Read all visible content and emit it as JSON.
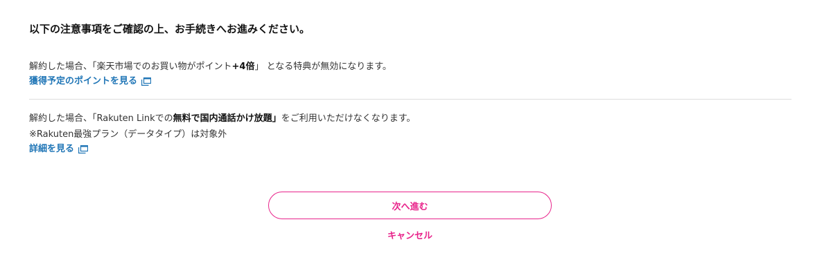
{
  "header": {
    "title": "以下の注意事項をご確認の上、お手続きへお進みください。"
  },
  "notices": [
    {
      "text_pre": "解約した場合、「楽天市場でのお買い物がポイント",
      "text_bold": "+4倍",
      "text_post": "」 となる特典が無効になります。",
      "link_label": "獲得予定のポイントを見る",
      "link_icon": "external-window-icon"
    },
    {
      "text_pre": "解約した場合、「Rakuten Linkでの",
      "text_bold": "無料で国内通話かけ放題」",
      "text_post": "をご利用いただけなくなります。",
      "sub_note": "※Rakuten最強プラン（データタイプ）は対象外",
      "link_label": "詳細を見る",
      "link_icon": "external-window-icon"
    }
  ],
  "actions": {
    "next_label": "次へ進む",
    "cancel_label": "キャンセル"
  },
  "colors": {
    "accent": "#e8228a",
    "link": "#1f75b6",
    "text": "#333333",
    "divider": "#dddddd"
  }
}
